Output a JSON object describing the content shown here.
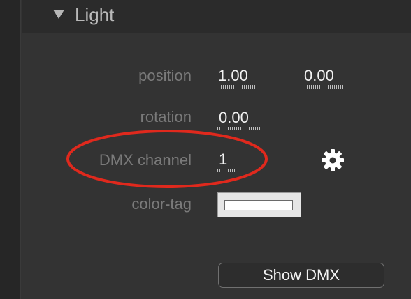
{
  "section": {
    "title": "Light",
    "collapse_icon": "triangle-down-icon"
  },
  "properties": {
    "position": {
      "label": "position",
      "x": "1.00",
      "y": "0.00"
    },
    "rotation": {
      "label": "rotation",
      "value": "0.00"
    },
    "dmx_channel": {
      "label": "DMX channel",
      "value": "1",
      "settings_icon": "gear-icon"
    },
    "color_tag": {
      "label": "color-tag",
      "swatch_color": "#ffffff"
    }
  },
  "show_dmx_button": {
    "label": "Show DMX"
  },
  "annotation": {
    "color": "#e0291d"
  }
}
